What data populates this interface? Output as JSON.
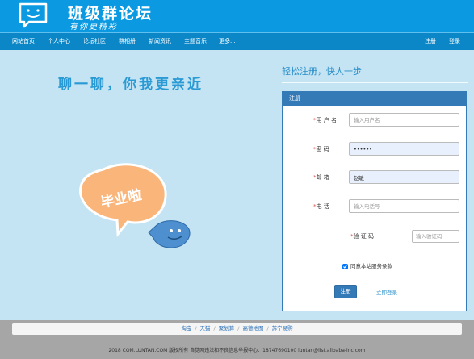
{
  "header": {
    "title": "班级群论坛",
    "slogan": "有你更精彩"
  },
  "nav": {
    "items": [
      {
        "label": "网站首页"
      },
      {
        "label": "个人中心"
      },
      {
        "label": "论坛社区"
      },
      {
        "label": "群相册"
      },
      {
        "label": "新闻资讯"
      },
      {
        "label": "主题音乐"
      },
      {
        "label": "更多..."
      }
    ],
    "register": "注册",
    "login": "登录"
  },
  "hero": {
    "slogan": "聊一聊，你我更亲近",
    "bubble_text": "毕业啦"
  },
  "register": {
    "heading": "轻松注册，快人一步",
    "panel_title": "注册",
    "fields": {
      "username": {
        "label": "用 户 名",
        "placeholder": "输入用户名",
        "value": ""
      },
      "password": {
        "label": "密    码",
        "placeholder": "",
        "value": "••••••"
      },
      "email": {
        "label": "邮    箱",
        "placeholder": "",
        "value": "赵敏"
      },
      "phone": {
        "label": "电    话",
        "placeholder": "输入电话号",
        "value": ""
      },
      "captcha": {
        "label": "验 证 码",
        "placeholder": "输入验证码",
        "value": ""
      }
    },
    "agree_label": "同意本站服务条款",
    "agree_checked": true,
    "submit_label": "注册",
    "login_link": "立即登录"
  },
  "footer": {
    "links": [
      "淘宝",
      "天猫",
      "聚划算",
      "高德地图",
      "苏宁易购"
    ],
    "copyright": "2018 COM.LUNTAN.COM 版权所有 自觉网违法和不良信息举报中心：18747690100 luntan@list.alibaba-inc.com"
  },
  "colors": {
    "header": "#0b9ae2",
    "nav": "#0b87c8",
    "page_bg": "#c4e3f3",
    "panel": "#337ab7",
    "footer": "#a6a6a6"
  }
}
